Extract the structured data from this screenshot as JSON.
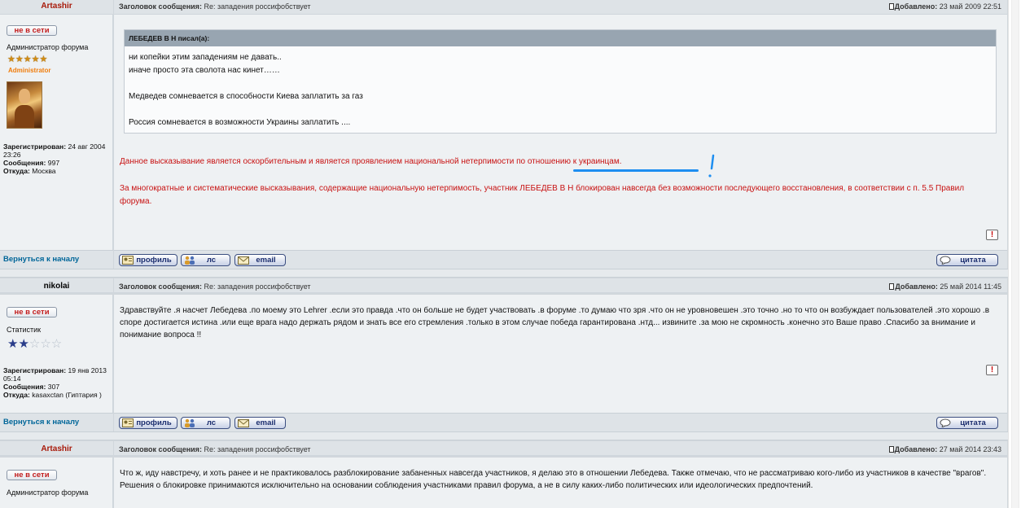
{
  "labels": {
    "subject_prefix": "Заголовок сообщения:",
    "added_prefix": "Добавлено:",
    "registered": "Зарегистрирован:",
    "messages": "Сообщения:",
    "from": "Откуда:",
    "back_to_top": "Вернуться к началу",
    "profile": "профиль",
    "pm": "лс",
    "email": "email",
    "quote": "цитата",
    "offline": "не в сети",
    "report": "!"
  },
  "posts": [
    {
      "author": "Artashir",
      "subject": "Re: западения россифобствует",
      "date": "23 май 2009 22:51",
      "rank_title": "Администратор форума",
      "rank_stars": "★★★★★",
      "rank_name": "Administrator",
      "registered": "24 авг 2004 23:26",
      "messages": "997",
      "from": "Москва",
      "quote": {
        "header": "ЛЕБЕДЕВ В Н писал(а):",
        "lines": [
          "ни копейки этим западениям не давать..",
          "иначе просто эта сволота нас кинет……",
          "",
          "Медведев сомневается в способности Киева заплатить за газ",
          "",
          "Россия сомневается в возможности Украины заплатить ...."
        ]
      },
      "moderator_text_1_a": "Данное высказывание является оскорбительным и является проявлением национальной нетерпимости ",
      "moderator_text_1_b": "по отношению к украинцам.",
      "moderator_text_2": "За многократные и систематические высказывания, содержащие национальную нетерпимость, участник ЛЕБЕДЕВ В Н блокирован навсегда без возможности последующего восстановления, в соответствии с п. 5.5 Правил форума."
    },
    {
      "author": "nikolai",
      "subject": "Re: западения россифобствует",
      "date": "25 май 2014 11:45",
      "rank_title": "Статистик",
      "rank_stars_full": "★★",
      "rank_stars_empty": "☆☆☆",
      "registered": "19 янв 2013 05:14",
      "messages": "307",
      "from": "kasaxctan (Гиптария )",
      "text": "Здравствуйте .я насчет Лебедева .по моему это Lehrer .если это правда .что он больше не будет участвовать .в форуме .то думаю что зря .что он не уровновешен .это точно .но то что он возбуждает пользователей .это хорошо .в споре достигается истина .или еще врага надо держать рядом и знать все его стремления .только в этом случае победа гарантирована .нтд... извините .за мою не скромность .конечно это Ваше право .Спасибо за внимание и понимание вопроса !!"
    },
    {
      "author": "Artashir",
      "subject": "Re: западения россифобствует",
      "date": "27 май 2014 23:43",
      "rank_title": "Администратор форума",
      "text": "Что ж, иду навстречу, и хоть ранее и не практиковалось разблокирование забаненных навсегда участников, я делаю это в отношении Лебедева. Также отмечаю, что не рассматриваю кого-либо из участников в качестве \"врагов\". Решения о блокировке принимаются исключительно на основании соблюдения участниками правил форума, а не в силу каких-либо политических или идеологических предпочтений."
    }
  ],
  "colors": {
    "admin_name": "#a81a0a",
    "moderator_red": "#c81212",
    "link_blue": "#006699",
    "annotation_blue": "#1e8ef0"
  }
}
